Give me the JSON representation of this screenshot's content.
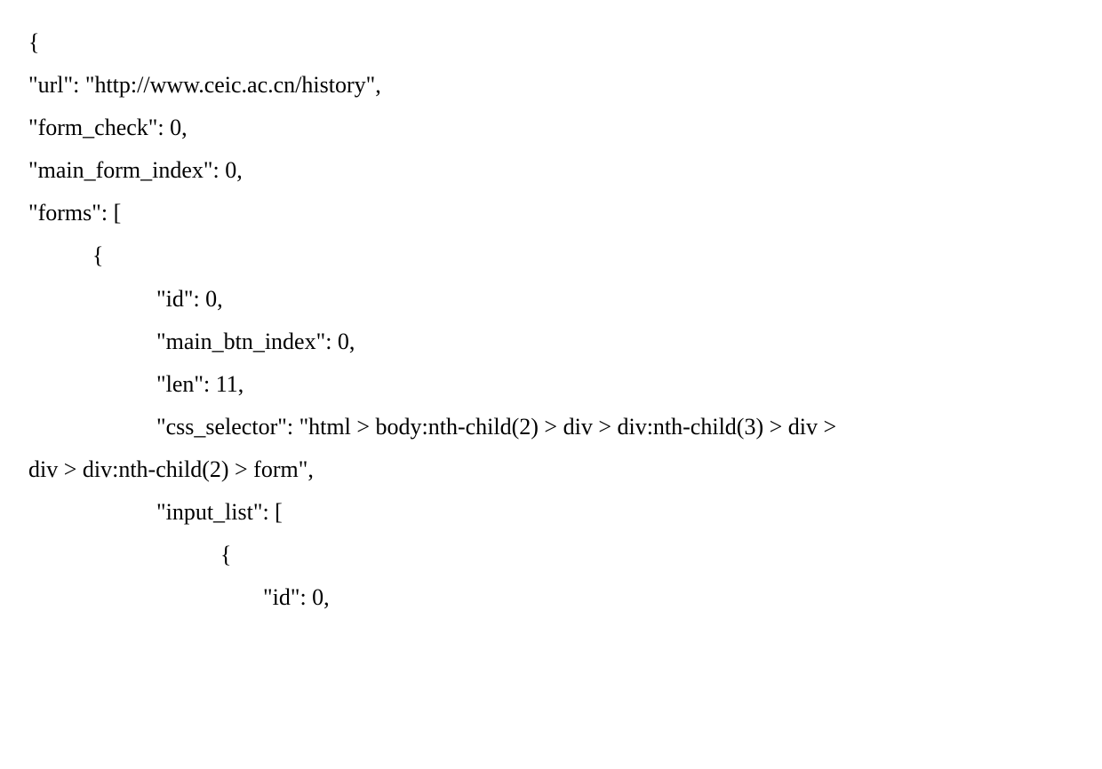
{
  "lines": {
    "l1": "{",
    "l2": "\"url\": \"http://www.ceic.ac.cn/history\",",
    "l3": "\"form_check\": 0,",
    "l4": "\"main_form_index\": 0,",
    "l5": "\"forms\": [",
    "l6": "{",
    "l7": "\"id\": 0,",
    "l8": "\"main_btn_index\": 0,",
    "l9": "\"len\": 11,",
    "l10a": "\"css_selector\": \"html > body:nth-child(2) > div > div:nth-child(3) > div >",
    "l10b": "div > div:nth-child(2) > form\",",
    "l11": "\"input_list\": [",
    "l12": "{",
    "l13": "\"id\": 0,"
  }
}
